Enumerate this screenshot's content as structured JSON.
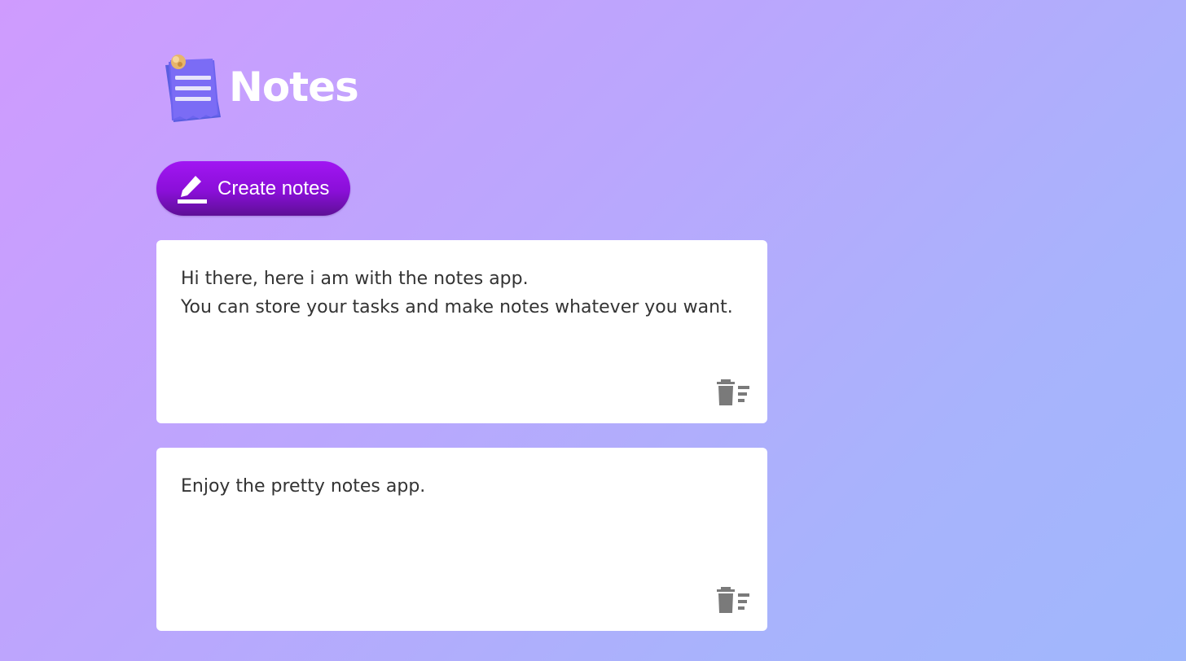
{
  "header": {
    "title": "Notes",
    "logo_icon": "notepad-pin-icon"
  },
  "toolbar": {
    "create_label": "Create notes",
    "create_icon": "pencil-edit-icon"
  },
  "notes": [
    {
      "text": "Hi there, here i am with the notes app.\nYou can store your tasks and make notes whatever you want.",
      "delete_icon": "trash-list-icon"
    },
    {
      "text": "Enjoy the pretty notes app.",
      "delete_icon": "trash-list-icon"
    }
  ],
  "colors": {
    "background_start": "#cf9bfe",
    "background_end": "#a0b7fc",
    "button": "#8a0fd8",
    "note_background": "#ffffff",
    "note_text": "#333333",
    "icon_gray": "#7a7a7a"
  }
}
